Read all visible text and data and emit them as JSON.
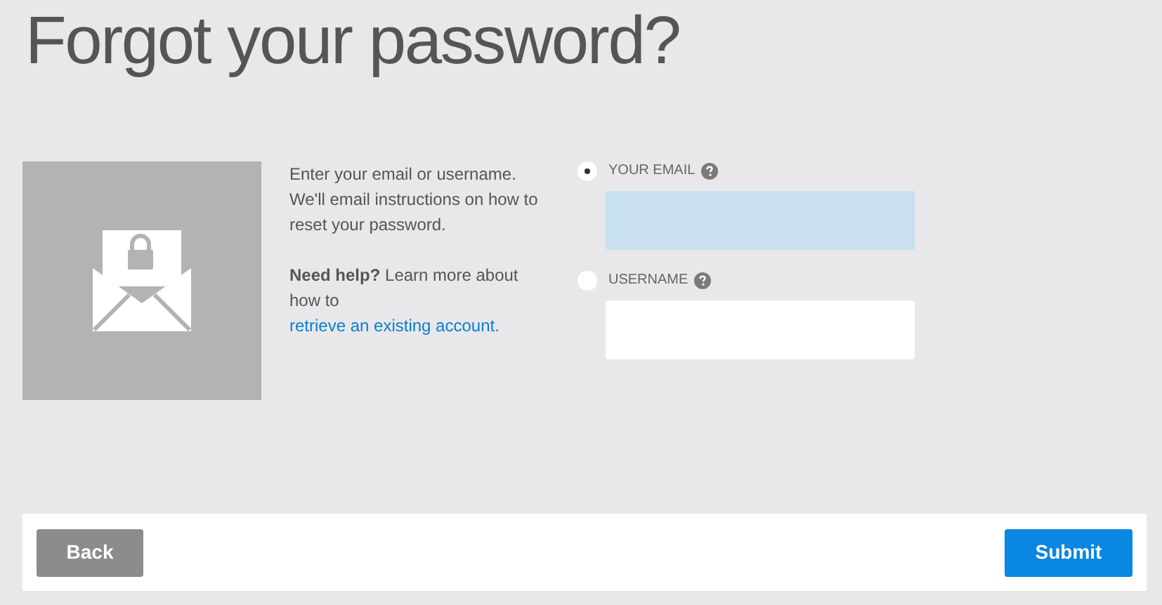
{
  "title": "Forgot your password?",
  "intro": "Enter your email or username. We'll email instructions on how to reset your password.",
  "help": {
    "lead": "**Need help?** Learn more about how to ",
    "link": "retrieve an existing account."
  },
  "options": [
    {
      "label": "YOUR EMAIL",
      "selected": true
    },
    {
      "label": "USERNAME",
      "selected": false
    }
  ],
  "buttons": {
    "back": "Back",
    "submit": "Submit"
  }
}
